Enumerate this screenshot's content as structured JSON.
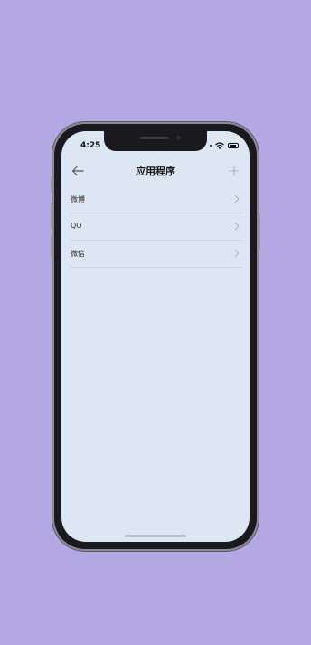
{
  "status_bar": {
    "time": "4:25"
  },
  "navbar": {
    "title": "应用程序",
    "back_icon": "arrow-left-icon",
    "add_icon": "plus-icon"
  },
  "list": {
    "items": [
      {
        "label": "微博"
      },
      {
        "label": "QQ"
      },
      {
        "label": "微信"
      }
    ]
  },
  "colors": {
    "background": "#b3a8e4",
    "screen": "#dde6f3",
    "divider": "#cfd7e4"
  }
}
